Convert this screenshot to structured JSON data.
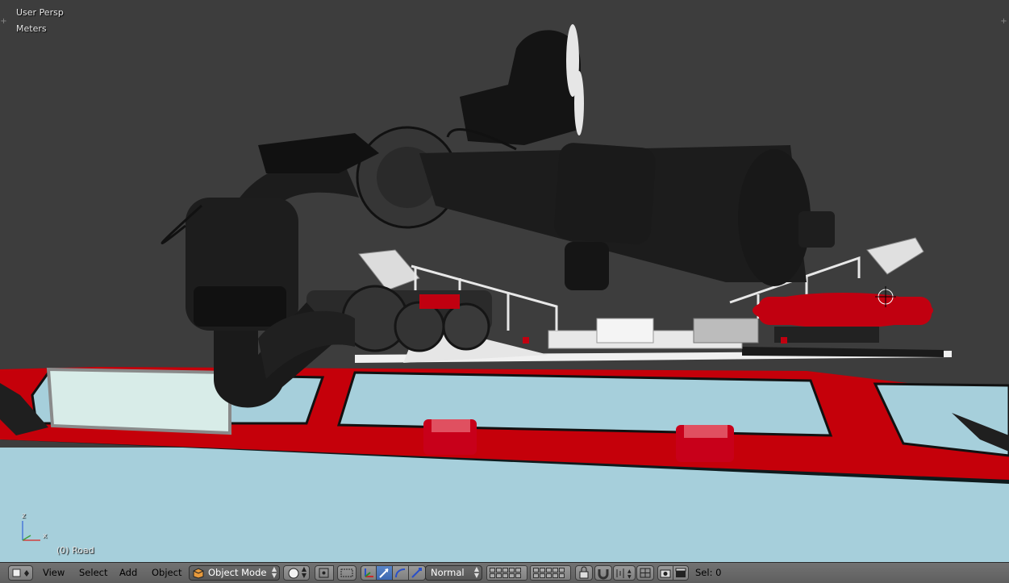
{
  "viewport": {
    "view_label": "User Persp",
    "units_label": "Meters",
    "object_label": "(0) Road",
    "axis": {
      "z": "z",
      "x": "x"
    },
    "colors": {
      "background": "#3d3d3d",
      "red": "#c00008",
      "road": "#a8d0dc",
      "dark": "#1a1a1a"
    }
  },
  "header": {
    "editor_type_icon": "3d-view-icon",
    "menus": [
      "View",
      "Select",
      "Add",
      "Object"
    ],
    "mode": {
      "icon": "cube-icon",
      "label": "Object Mode"
    },
    "shading_icon": "sphere-shading-icon",
    "pivot_icon": "pivot-icon",
    "manipulator_icons": [
      "translate-icon",
      "rotate-icon",
      "scale-icon"
    ],
    "orientation": "Normal",
    "layers_icon": "layers-icon",
    "lock_icon": "lock-icon",
    "snap_icon": "magnet-icon",
    "render_icons": [
      "camera-icon",
      "clapper-icon"
    ],
    "status": "Sel: 0"
  }
}
